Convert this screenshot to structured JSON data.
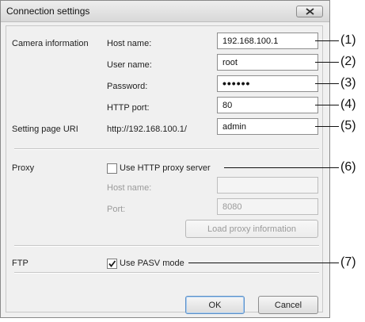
{
  "window": {
    "title": "Connection settings"
  },
  "camera": {
    "section_label": "Camera information",
    "host_label": "Host name:",
    "host_value": "192.168.100.1",
    "user_label": "User name:",
    "user_value": "root",
    "password_label": "Password:",
    "password_mask": "••••••",
    "http_port_label": "HTTP port:",
    "http_port_value": "80"
  },
  "setting_page": {
    "label": "Setting page URI",
    "prefix": "http://192.168.100.1/",
    "value": "admin"
  },
  "proxy": {
    "section_label": "Proxy",
    "use_proxy_label": "Use HTTP proxy server",
    "use_proxy_checked": false,
    "host_label": "Host name:",
    "host_value": "",
    "port_label": "Port:",
    "port_value": "8080",
    "load_button": "Load proxy information"
  },
  "ftp": {
    "section_label": "FTP",
    "pasv_label": "Use PASV mode",
    "pasv_checked": true
  },
  "buttons": {
    "ok": "OK",
    "cancel": "Cancel"
  },
  "callouts": [
    "(1)",
    "(2)",
    "(3)",
    "(4)",
    "(5)",
    "(6)",
    "(7)"
  ],
  "icons": {
    "close": "close-icon",
    "checkmark": "checkmark-icon"
  }
}
